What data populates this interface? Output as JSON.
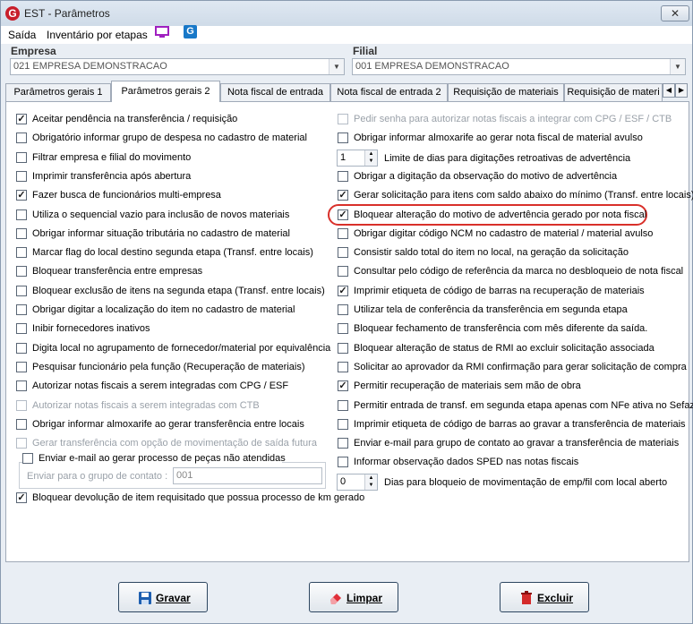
{
  "window": {
    "title": "EST - Parâmetros",
    "close": "✕"
  },
  "menu": {
    "items": [
      "Saída",
      "Inventário por etapas"
    ]
  },
  "empresa": {
    "label": "Empresa",
    "value": "021 EMPRESA DEMONSTRACAO"
  },
  "filial": {
    "label": "Filial",
    "value": "001 EMPRESA DEMONSTRACAO"
  },
  "tabs": [
    "Parâmetros gerais 1",
    "Parâmetros gerais 2",
    "Nota fiscal de entrada",
    "Nota fiscal de entrada 2",
    "Requisição de materiais",
    "Requisição de materi"
  ],
  "active_tab": 1,
  "left": [
    {
      "label": "Aceitar pendência na transferência / requisição",
      "checked": true,
      "disabled": false
    },
    {
      "label": "Obrigatório informar grupo de despesa no cadastro de material",
      "checked": false,
      "disabled": false
    },
    {
      "label": "Filtrar empresa e filial do movimento",
      "checked": false,
      "disabled": false
    },
    {
      "label": "Imprimir transferência após abertura",
      "checked": false,
      "disabled": false
    },
    {
      "label": "Fazer busca de funcionários multi-empresa",
      "checked": true,
      "disabled": false
    },
    {
      "label": "Utiliza o sequencial vazio para inclusão de novos materiais",
      "checked": false,
      "disabled": false
    },
    {
      "label": "Obrigar informar situação tributária no cadastro de material",
      "checked": false,
      "disabled": false
    },
    {
      "label": "Marcar flag do local destino segunda etapa (Transf. entre locais)",
      "checked": false,
      "disabled": false
    },
    {
      "label": "Bloquear transferência entre empresas",
      "checked": false,
      "disabled": false
    },
    {
      "label": "Bloquear exclusão de itens na segunda etapa (Transf. entre locais)",
      "checked": false,
      "disabled": false
    },
    {
      "label": "Obrigar digitar a localização do item no cadastro de material",
      "checked": false,
      "disabled": false
    },
    {
      "label": "Inibir fornecedores inativos",
      "checked": false,
      "disabled": false
    },
    {
      "label": "Digita local no agrupamento de fornecedor/material por equivalência",
      "checked": false,
      "disabled": false
    },
    {
      "label": "Pesquisar funcionário pela função (Recuperação de materiais)",
      "checked": false,
      "disabled": false
    },
    {
      "label": "Autorizar notas fiscais a serem integradas com CPG / ESF",
      "checked": false,
      "disabled": false
    },
    {
      "label": "Autorizar notas fiscais a serem integradas com CTB",
      "checked": false,
      "disabled": true
    },
    {
      "label": "Obrigar informar almoxarife ao gerar transferência entre locais",
      "checked": false,
      "disabled": false
    },
    {
      "label": "Gerar transferência com opção de movimentação de saída futura",
      "checked": false,
      "disabled": true
    }
  ],
  "email_group": {
    "checkbox": "Enviar e-mail ao gerar processo de peças não atendidas",
    "contact_label": "Enviar para o grupo de contato :",
    "contact_value": "001"
  },
  "bottom_check": {
    "label": "Bloquear devolução de item requisitado que possua processo de km gerado",
    "checked": true
  },
  "right": [
    {
      "kind": "cb",
      "label": "Pedir senha para autorizar notas fiscais a integrar com CPG / ESF / CTB",
      "checked": false,
      "disabled": true
    },
    {
      "kind": "cb",
      "label": "Obrigar informar almoxarife ao gerar nota fiscal de material avulso",
      "checked": false,
      "disabled": false
    },
    {
      "kind": "spin",
      "value": "1",
      "label": "Limite de dias para digitações retroativas de advertência"
    },
    {
      "kind": "cb",
      "label": "Obrigar a digitação da observação do motivo de advertência",
      "checked": false,
      "disabled": false
    },
    {
      "kind": "cb",
      "label": "Gerar solicitação para itens com saldo abaixo do mínimo (Transf. entre locais)",
      "checked": true,
      "disabled": false
    },
    {
      "kind": "cb",
      "label": "Bloquear alteração do motivo de advertência gerado por nota fiscal",
      "checked": true,
      "disabled": false
    },
    {
      "kind": "cb",
      "label": "Obrigar digitar código NCM no cadastro de material / material avulso",
      "checked": false,
      "disabled": false
    },
    {
      "kind": "cb",
      "label": "Consistir saldo total do item no local, na geração da solicitação",
      "checked": false,
      "disabled": false
    },
    {
      "kind": "cb",
      "label": "Consultar pelo código de referência da marca no desbloqueio de nota fiscal",
      "checked": false,
      "disabled": false
    },
    {
      "kind": "cb",
      "label": "Imprimir etiqueta de código de barras na recuperação de materiais",
      "checked": true,
      "disabled": false
    },
    {
      "kind": "cb",
      "label": "Utilizar tela de conferência da transferência em segunda etapa",
      "checked": false,
      "disabled": false
    },
    {
      "kind": "cb",
      "label": "Bloquear fechamento de transferência com mês diferente da saída.",
      "checked": false,
      "disabled": false
    },
    {
      "kind": "cb",
      "label": "Bloquear alteração de status de RMI ao excluir solicitação associada",
      "checked": false,
      "disabled": false
    },
    {
      "kind": "cb",
      "label": "Solicitar ao aprovador da RMI confirmação para gerar solicitação de compra",
      "checked": false,
      "disabled": false
    },
    {
      "kind": "cb",
      "label": "Permitir recuperação de materiais sem mão de obra",
      "checked": true,
      "disabled": false
    },
    {
      "kind": "cb",
      "label": "Permitir entrada de transf. em segunda etapa apenas com NFe ativa no Sefaz",
      "checked": false,
      "disabled": false
    },
    {
      "kind": "cb",
      "label": "Imprimir etiqueta de código de barras ao gravar a transferência de materiais",
      "checked": false,
      "disabled": false
    },
    {
      "kind": "cb",
      "label": "Enviar e-mail para grupo de contato ao gravar a transferência de materiais",
      "checked": false,
      "disabled": false
    },
    {
      "kind": "cb",
      "label": "Informar observação dados SPED nas notas fiscais",
      "checked": false,
      "disabled": false
    },
    {
      "kind": "spin",
      "value": "0",
      "label": "Dias para bloqueio de movimentação de emp/fil com local aberto"
    }
  ],
  "buttons": {
    "save": "Gravar",
    "clear": "Limpar",
    "delete": "Excluir"
  }
}
